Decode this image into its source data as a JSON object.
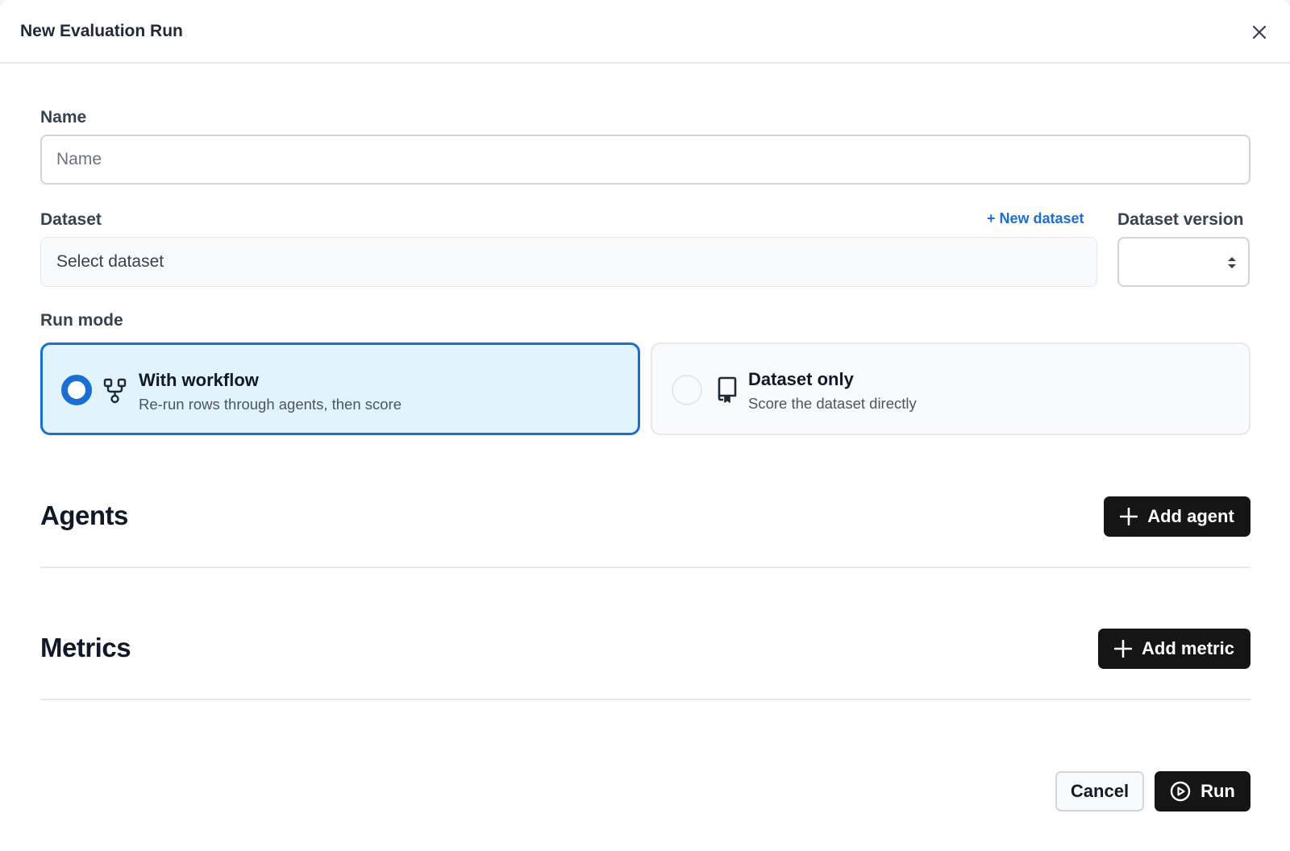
{
  "dialog": {
    "title": "New Evaluation Run"
  },
  "form": {
    "name": {
      "label": "Name",
      "placeholder": "Name",
      "value": ""
    },
    "dataset": {
      "label": "Dataset",
      "placeholder": "Select dataset",
      "new_dataset_link": "+ New dataset"
    },
    "dataset_version": {
      "label": "Dataset version",
      "value": ""
    },
    "run_mode": {
      "label": "Run mode",
      "selected": "with_workflow",
      "options": [
        {
          "id": "with_workflow",
          "title": "With workflow",
          "description": "Re-run rows through agents, then score",
          "icon": "workflow-icon"
        },
        {
          "id": "dataset_only",
          "title": "Dataset only",
          "description": "Score the dataset directly",
          "icon": "bookmark-icon"
        }
      ]
    }
  },
  "agents": {
    "heading": "Agents",
    "add_label": "Add agent"
  },
  "metrics": {
    "heading": "Metrics",
    "add_label": "Add metric"
  },
  "footer": {
    "cancel_label": "Cancel",
    "run_label": "Run"
  },
  "colors": {
    "accent": "#1b6fd0",
    "selected_card_bg": "#e1f3fc",
    "dark_button": "#151515",
    "link": "#1d6fd6"
  }
}
